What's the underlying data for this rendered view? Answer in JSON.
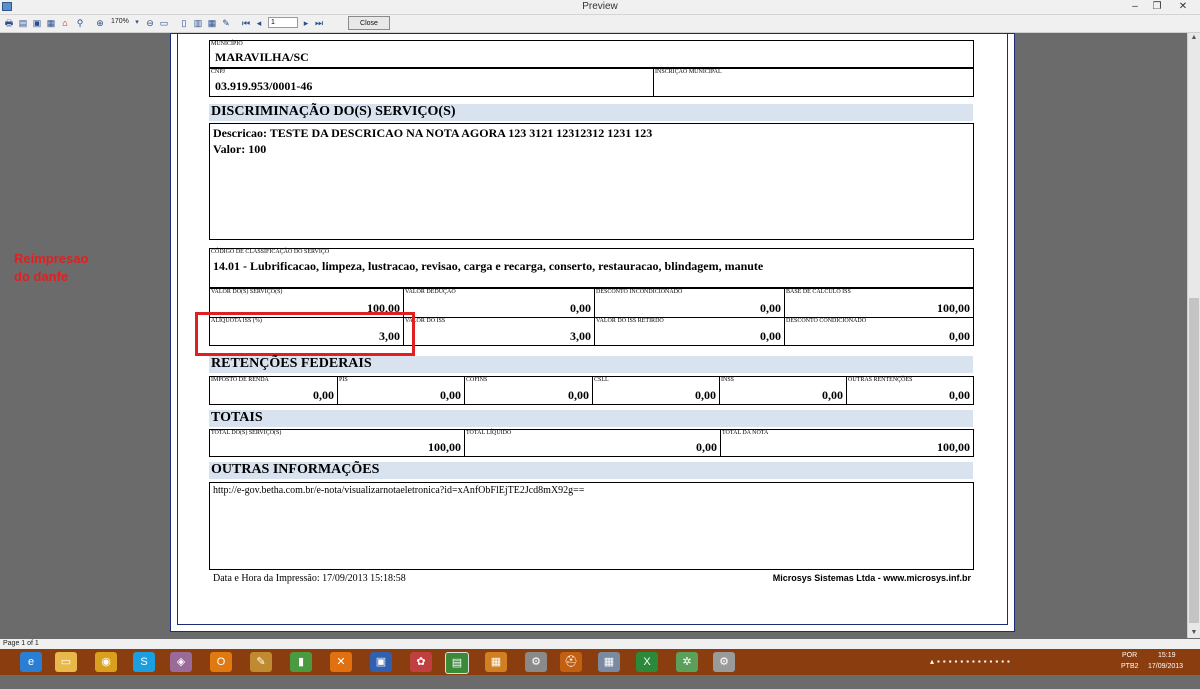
{
  "window": {
    "title": "Preview"
  },
  "toolbar": {
    "zoom": "170%",
    "page_value": "1",
    "close_label": "Close"
  },
  "side_note": {
    "line1": "Reimpresao",
    "line2": "do danfe"
  },
  "doc": {
    "municipio": {
      "label": "MUNICÍPIO",
      "value": "MARAVILHA/SC"
    },
    "cnpj": {
      "label": "CNPJ",
      "value": "03.919.953/0001-46"
    },
    "inscricao": {
      "label": "INSCRIÇÃO MUNICIPAL",
      "value": ""
    },
    "discriminacao": {
      "title": "DISCRIMINAÇÃO DO(S) SERVIÇO(S)",
      "line1": "Descricao: TESTE DA DESCRICAO NA NOTA AGORA 123 3121 12312312 1231 123",
      "line2": "Valor: 100"
    },
    "classificacao": {
      "label": "CÓDIGO DE CLASSIFICAÇÃO DO SERVIÇO",
      "value": "14.01 - Lubrificacao, limpeza, lustracao, revisao, carga e recarga, conserto, restauracao, blindagem, manute"
    },
    "valores_row1": [
      {
        "label": "VALOR DO(S) SERVIÇO(S)",
        "value": "100,00"
      },
      {
        "label": "VALOR DEDUÇÃO",
        "value": "0,00"
      },
      {
        "label": "DESCONTO INCONDICIONADO",
        "value": "0,00"
      },
      {
        "label": "BASE DE CÁLCULO ISS",
        "value": "100,00"
      }
    ],
    "valores_row2": [
      {
        "label": "ALÍQUOTA ISS (%)",
        "value": "3,00"
      },
      {
        "label": "VALOR DO ISS",
        "value": "3,00"
      },
      {
        "label": "VALOR DO ISS RETIRDO",
        "value": "0,00"
      },
      {
        "label": "DESCONTO CONDICIONADO",
        "value": "0,00"
      }
    ],
    "retencoes": {
      "title": "RETENÇÕES FEDERAIS",
      "items": [
        {
          "label": "IMPOSTO DE RENDA",
          "value": "0,00"
        },
        {
          "label": "PIS",
          "value": "0,00"
        },
        {
          "label": "COFINS",
          "value": "0,00"
        },
        {
          "label": "CSLL",
          "value": "0,00"
        },
        {
          "label": "INSS",
          "value": "0,00"
        },
        {
          "label": "OUTRAS RENTENÇÕES",
          "value": "0,00"
        }
      ]
    },
    "totais": {
      "title": "TOTAIS",
      "items": [
        {
          "label": "TOTAL DO(S) SERVIÇO(S)",
          "value": "100,00"
        },
        {
          "label": "TOTAL LÍQUIDO",
          "value": "0,00"
        },
        {
          "label": "TOTAL DA NOTA",
          "value": "100,00"
        }
      ]
    },
    "outras": {
      "title": "OUTRAS INFORMAÇÕES",
      "text": "http://e-gov.betha.com.br/e-nota/visualizarnotaeletronica?id=xAnfObFlEjTE2Jcd8mX92g=="
    },
    "footer_left": "Data e Hora da Impressão: 17/09/2013   15:18:58",
    "footer_right": "Microsys Sistemas Ltda - www.microsys.inf.br"
  },
  "status": {
    "page": "Page 1 of 1"
  },
  "taskbar": {
    "lang": "POR",
    "layout": "PTB2",
    "time": "15:19",
    "date": "17/09/2013"
  }
}
